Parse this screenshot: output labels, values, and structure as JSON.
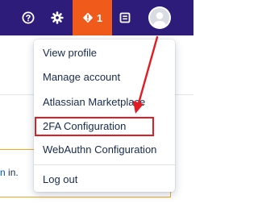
{
  "topbar": {
    "bg_color": "#2d1c7a",
    "help_icon": "question-circle-icon",
    "settings_icon": "gear-icon",
    "alert_icon": "exclamation-diamond-icon",
    "alert_count": "1",
    "alert_bg": "#f05a1a",
    "doc_icon": "document-list-icon",
    "avatar_icon": "user-avatar-icon"
  },
  "background": {
    "partial_text_link": "n",
    "partial_text_rest": " in."
  },
  "profile_menu": {
    "items": [
      {
        "label": "View profile"
      },
      {
        "label": "Manage account"
      },
      {
        "label": "Atlassian Marketplace"
      },
      {
        "label": "2FA Configuration"
      },
      {
        "label": "WebAuthn Configuration"
      },
      {
        "label": "Log out"
      }
    ]
  },
  "annotation": {
    "color": "#e31b23",
    "highlighted_item": "2FA Configuration"
  }
}
